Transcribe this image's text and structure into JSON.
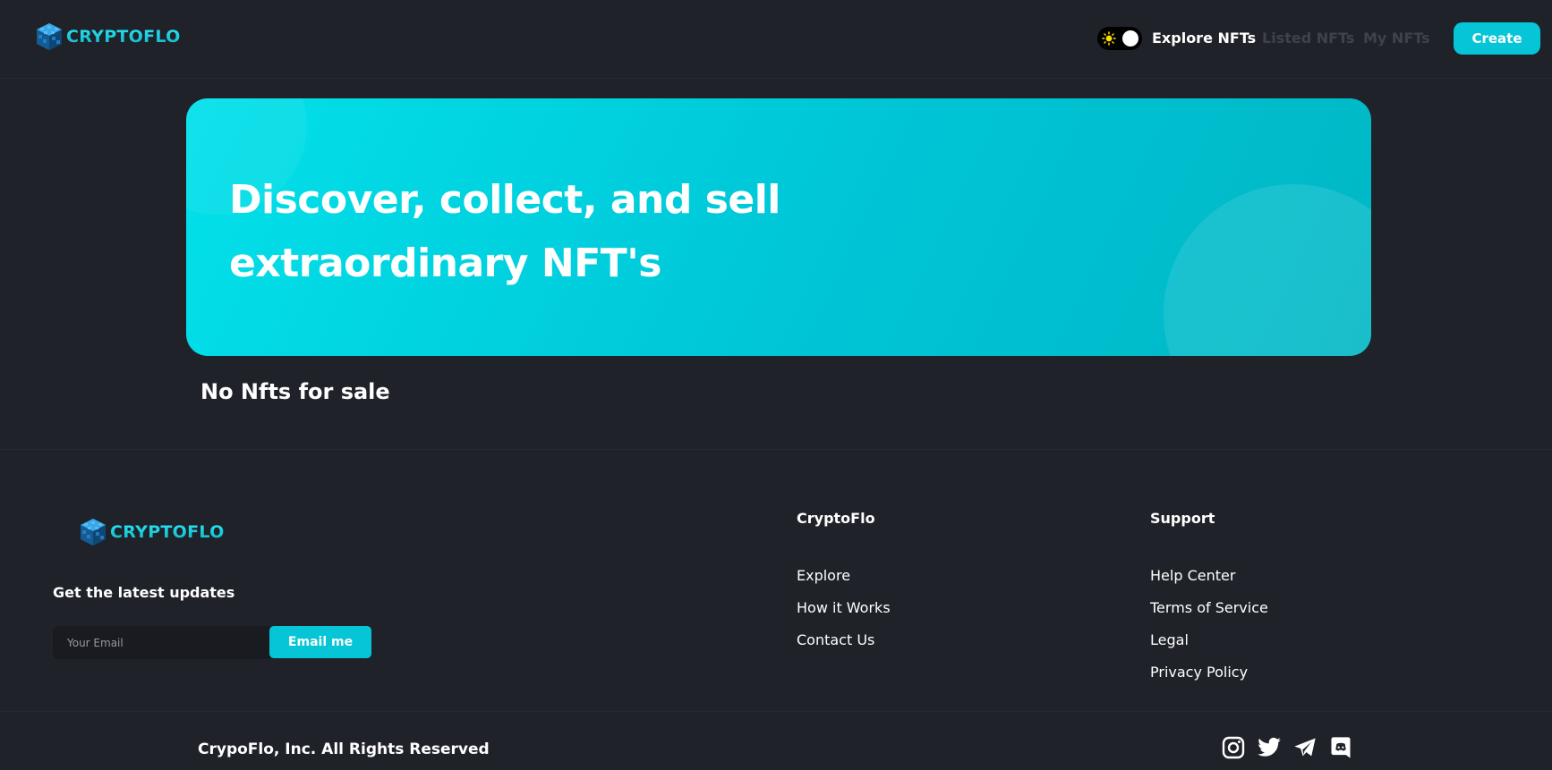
{
  "header": {
    "brand": "CRYPTOFLO",
    "nav": {
      "explore": "Explore NFTs",
      "listed": "Listed NFTs",
      "my": "My NFTs"
    },
    "create_label": "Create",
    "theme_toggle_icon": "sun-icon"
  },
  "hero": {
    "line1": "Discover, collect, and sell",
    "line2": "extraordinary NFT's"
  },
  "main": {
    "empty_message": "No Nfts for sale"
  },
  "footer": {
    "brand": "CRYPTOFLO",
    "updates_label": "Get the latest updates",
    "email_placeholder": "Your Email",
    "email_button": "Email me",
    "columns": [
      {
        "title": "CryptoFlo",
        "links": [
          "Explore",
          "How it Works",
          "Contact Us"
        ]
      },
      {
        "title": "Support",
        "links": [
          "Help Center",
          "Terms of Service",
          "Legal",
          "Privacy Policy"
        ]
      }
    ],
    "copyright": "CrypoFlo, Inc. All Rights Reserved",
    "social_icons": [
      "instagram-icon",
      "twitter-icon",
      "telegram-icon",
      "discord-icon"
    ]
  },
  "colors": {
    "background": "#20222a",
    "accent": "#05c5d6",
    "hero_start": "#02e1ea",
    "hero_end": "#00b7c5",
    "nav_inactive": "#3f424b"
  }
}
